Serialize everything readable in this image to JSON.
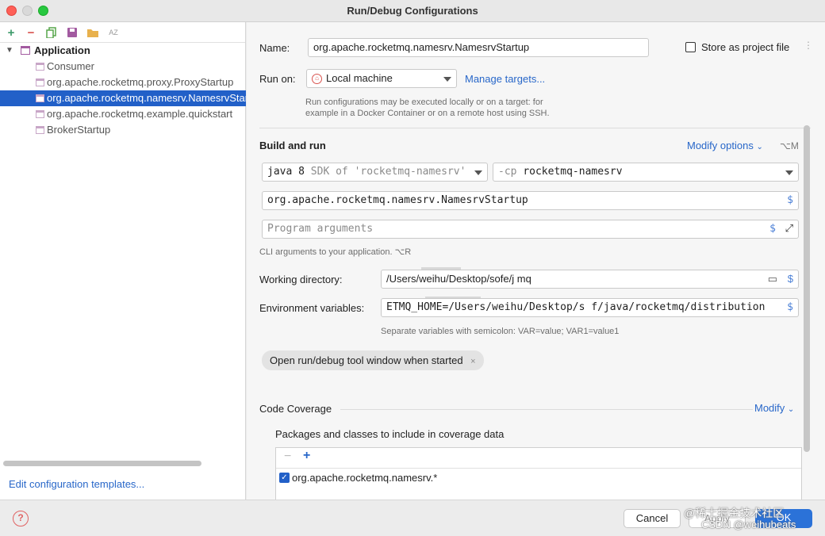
{
  "window": {
    "title": "Run/Debug Configurations"
  },
  "toolbar": {
    "icons": [
      "add-icon",
      "remove-icon",
      "copy-icon",
      "save-icon",
      "folder-icon",
      "sort-icon"
    ]
  },
  "tree": {
    "root": "Application",
    "items": [
      {
        "label": "Consumer",
        "selected": false
      },
      {
        "label": "org.apache.rocketmq.proxy.ProxyStartup",
        "selected": false
      },
      {
        "label": "org.apache.rocketmq.namesrv.NamesrvStartup",
        "selected": true
      },
      {
        "label": "org.apache.rocketmq.example.quickstart",
        "selected": false
      },
      {
        "label": "BrokerStartup",
        "selected": false
      }
    ]
  },
  "edit_templates": "Edit configuration templates...",
  "form": {
    "name_label": "Name:",
    "name_value": "org.apache.rocketmq.namesrv.NamesrvStartup",
    "store_label": "Store as project file",
    "store_checked": false,
    "run_on_label": "Run on:",
    "run_on_value": "Local machine",
    "manage_targets": "Manage targets...",
    "run_on_help": "Run configurations may be executed locally or on a target: for example in a Docker Container or on a remote host using SSH.",
    "build_and_run": "Build and run",
    "modify_options": "Modify options",
    "modify_shortcut": "⌥M",
    "sdk_value": "java 8",
    "sdk_hint": "SDK of 'rocketmq-namesrv'",
    "cp_flag": "-cp",
    "cp_value": "rocketmq-namesrv",
    "main_class": "org.apache.rocketmq.namesrv.NamesrvStartup",
    "program_args_placeholder": "Program arguments",
    "cli_help": "CLI arguments to your application. ⌥R",
    "working_dir_label": "Working directory:",
    "working_dir_value": "/Users/weihu/Desktop/sofe/j        mq",
    "env_label": "Environment variables:",
    "env_value": "ETMQ_HOME=/Users/weihu/Desktop/s  f/java/rocketmq/distribution",
    "env_help": "Separate variables with semicolon: VAR=value; VAR1=value1",
    "chip_label": "Open run/debug tool window when started",
    "code_coverage": "Code Coverage",
    "modify": "Modify",
    "packages_label": "Packages and classes to include in coverage data",
    "package_item": "org.apache.rocketmq.namesrv.*",
    "package_checked": true
  },
  "buttons": {
    "cancel": "Cancel",
    "apply": "Apply",
    "ok": "OK"
  },
  "watermark": {
    "line1": "@稀土掘金技术社区",
    "line2": "CSDN @weihubeats"
  },
  "colors": {
    "accent": "#2260c8",
    "link": "#2867c9",
    "selection": "#2260c8"
  }
}
